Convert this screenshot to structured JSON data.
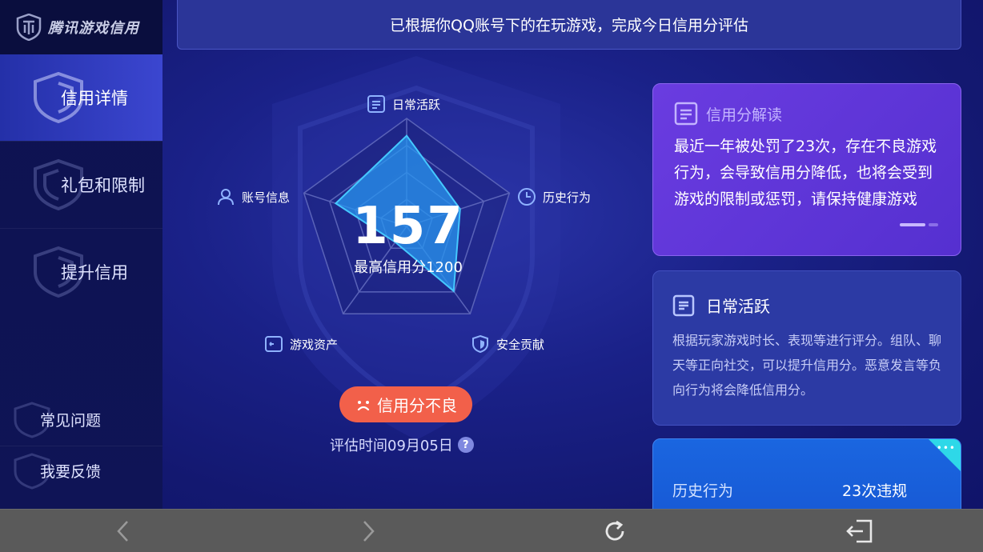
{
  "app": {
    "brand": "腾讯游戏信用"
  },
  "sidebar": {
    "items": [
      {
        "label": "信用详情",
        "active": true
      },
      {
        "label": "礼包和限制",
        "active": false
      },
      {
        "label": "提升信用",
        "active": false
      }
    ],
    "footer": [
      {
        "label": "常见问题"
      },
      {
        "label": "我要反馈"
      }
    ]
  },
  "banner": {
    "text": "已根据你QQ账号下的在玩游戏，完成今日信用分评估"
  },
  "radar": {
    "score": "157",
    "max_label": "最高信用分1200",
    "axes": [
      {
        "label": "日常活跃",
        "icon": "list-icon"
      },
      {
        "label": "历史行为",
        "icon": "clock-icon"
      },
      {
        "label": "安全贡献",
        "icon": "shield-icon"
      },
      {
        "label": "游戏资产",
        "icon": "wallet-icon"
      },
      {
        "label": "账号信息",
        "icon": "user-icon"
      }
    ],
    "values": [
      0.84,
      0.52,
      0.74,
      0.18,
      0.69
    ]
  },
  "status": {
    "label": "信用分不良",
    "color": "#f2604a"
  },
  "eval_time": {
    "text": "评估时间09月05日",
    "help": "?"
  },
  "cards": {
    "interpretation": {
      "title": "信用分解读",
      "body": "最近一年被处罚了23次，存在不良游戏行为，会导致信用分降低，也将会受到游戏的限制或惩罚，请保持健康游戏"
    },
    "daily": {
      "title": "日常活跃",
      "body": "根据玩家游戏时长、表现等进行评分。组队、聊天等正向社交，可以提升信用分。恶意发言等负向行为将会降低信用分。"
    },
    "history": {
      "key": "历史行为",
      "value": "23次违规"
    }
  },
  "colors": {
    "accent": "#3b46d0",
    "card_purple": "#5f36d8",
    "card_blue": "#1a66e0",
    "bad": "#f2604a"
  }
}
